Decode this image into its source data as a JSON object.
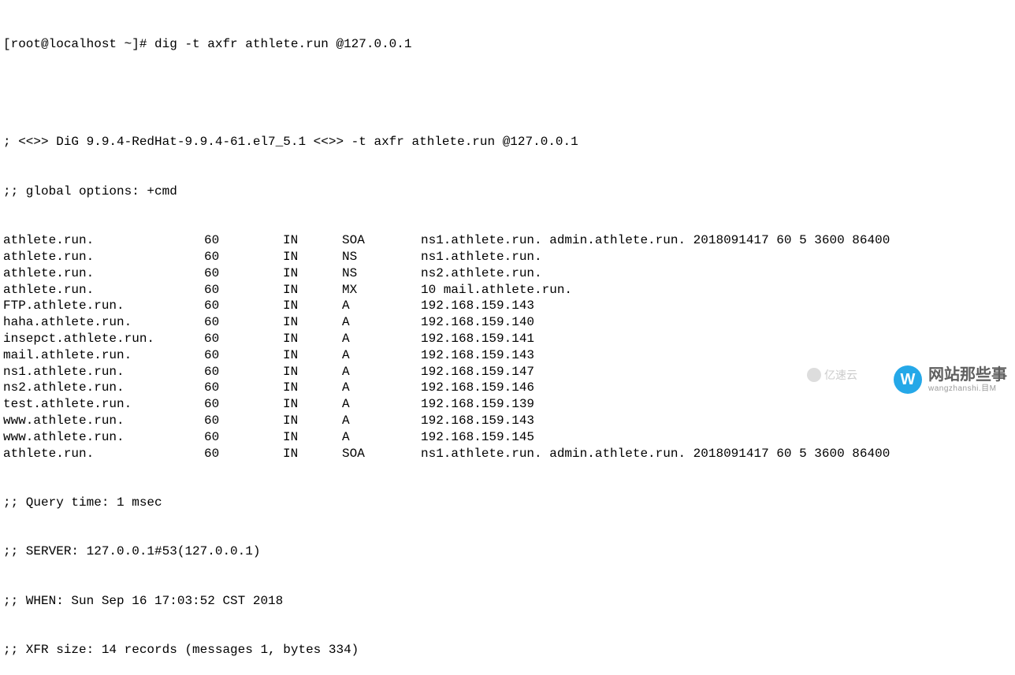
{
  "prompt": "[root@localhost ~]# dig -t axfr athlete.run @127.0.0.1",
  "header1": "; <<>> DiG 9.9.4-RedHat-9.9.4-61.el7_5.1 <<>> -t axfr athlete.run @127.0.0.1",
  "header2": ";; global options: +cmd",
  "records": [
    {
      "name": "athlete.run.",
      "ttl": "60",
      "class": "IN",
      "type": "SOA",
      "data": "ns1.athlete.run. admin.athlete.run. 2018091417 60 5 3600 86400"
    },
    {
      "name": "athlete.run.",
      "ttl": "60",
      "class": "IN",
      "type": "NS",
      "data": "ns1.athlete.run."
    },
    {
      "name": "athlete.run.",
      "ttl": "60",
      "class": "IN",
      "type": "NS",
      "data": "ns2.athlete.run."
    },
    {
      "name": "athlete.run.",
      "ttl": "60",
      "class": "IN",
      "type": "MX",
      "data": "10 mail.athlete.run."
    },
    {
      "name": "FTP.athlete.run.",
      "ttl": "60",
      "class": "IN",
      "type": "A",
      "data": "192.168.159.143"
    },
    {
      "name": "haha.athlete.run.",
      "ttl": "60",
      "class": "IN",
      "type": "A",
      "data": "192.168.159.140"
    },
    {
      "name": "insepct.athlete.run.",
      "ttl": "60",
      "class": "IN",
      "type": "A",
      "data": "192.168.159.141"
    },
    {
      "name": "mail.athlete.run.",
      "ttl": "60",
      "class": "IN",
      "type": "A",
      "data": "192.168.159.143"
    },
    {
      "name": "ns1.athlete.run.",
      "ttl": "60",
      "class": "IN",
      "type": "A",
      "data": "192.168.159.147"
    },
    {
      "name": "ns2.athlete.run.",
      "ttl": "60",
      "class": "IN",
      "type": "A",
      "data": "192.168.159.146"
    },
    {
      "name": "test.athlete.run.",
      "ttl": "60",
      "class": "IN",
      "type": "A",
      "data": "192.168.159.139"
    },
    {
      "name": "www.athlete.run.",
      "ttl": "60",
      "class": "IN",
      "type": "A",
      "data": "192.168.159.143"
    },
    {
      "name": "www.athlete.run.",
      "ttl": "60",
      "class": "IN",
      "type": "A",
      "data": "192.168.159.145"
    },
    {
      "name": "athlete.run.",
      "ttl": "60",
      "class": "IN",
      "type": "SOA",
      "data": "ns1.athlete.run. admin.athlete.run. 2018091417 60 5 3600 86400"
    }
  ],
  "footer1": ";; Query time: 1 msec",
  "footer2": ";; SERVER: 127.0.0.1#53(127.0.0.1)",
  "footer3": ";; WHEN: Sun Sep 16 17:03:52 CST 2018",
  "footer4": ";; XFR size: 14 records (messages 1, bytes 334)",
  "watermark_left": "亿速云",
  "watermark_right_symbol": "W",
  "watermark_right_text": "网站那些事",
  "watermark_right_sub": "wangzhanshi.目M"
}
